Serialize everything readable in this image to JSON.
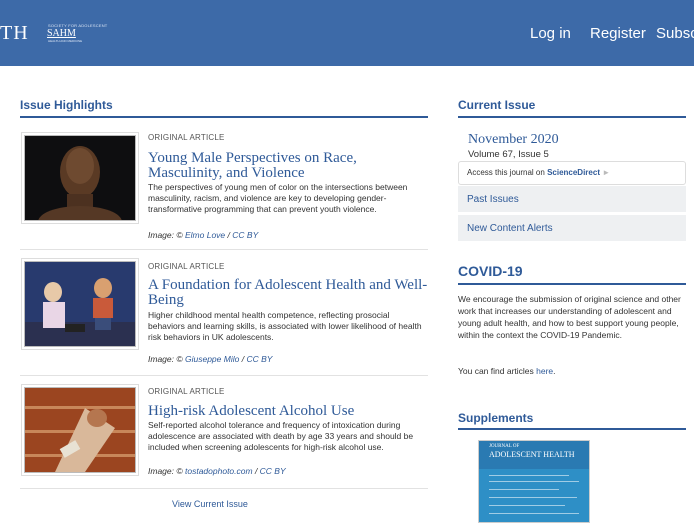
{
  "header": {
    "brand_partial": "TH",
    "logo_main": "SAHM",
    "logo_small": "SOCIETY FOR ADOLESCENT",
    "logo_sub": "HEALTH AND MEDICINE",
    "nav": {
      "login": "Log in",
      "register": "Register",
      "subscribe": "Subsc"
    }
  },
  "highlights": {
    "title": "Issue Highlights",
    "articles": [
      {
        "type": "ORIGINAL ARTICLE",
        "title": "Young Male Perspectives on Race, Masculinity, and Violence",
        "description": "The perspectives of young men of color on the intersections between masculinity, racism, and violence are key to developing gender-transformative programming that can prevent youth violence.",
        "credit_prefix": "Image: ©",
        "credit_name": "Elmo Love",
        "credit_license": "CC BY"
      },
      {
        "type": "ORIGINAL ARTICLE",
        "title": "A Foundation for Adolescent Health and Well-Being",
        "description": "Higher childhood mental health competence, reflecting prosocial behaviors and learning skills, is associated with lower likelihood of health risk behaviors in UK adolescents.",
        "credit_prefix": "Image: ©",
        "credit_name": "Giuseppe Milo",
        "credit_license": "CC BY"
      },
      {
        "type": "ORIGINAL ARTICLE",
        "title": "High-risk Adolescent Alcohol Use",
        "description": "Self-reported alcohol tolerance and frequency of intoxication during adolescence are associated with death by age 33 years and should be included when screening adolescents for high-risk alcohol use.",
        "credit_prefix": "Image: ©",
        "credit_name": "tostadophoto.com",
        "credit_license": "CC BY"
      }
    ],
    "view_current": "View Current Issue"
  },
  "current_issue": {
    "title": "Current Issue",
    "date": "November 2020",
    "volume": "Volume 67, Issue 5",
    "access_prefix": "Access this journal on",
    "access_brand": "ScienceDirect",
    "past_issues": "Past Issues",
    "alerts": "New Content Alerts"
  },
  "covid": {
    "title": "COVID-19",
    "body": "We encourage the submission of original science and other work that increases our understanding of adolescent and young adult health, and how to best support young people, within the context the COVID-19 Pandemic.",
    "find_prefix": "You can find articles",
    "find_link": "here",
    "find_suffix": "."
  },
  "supplements": {
    "title": "Supplements",
    "cover_journal_small": "JOURNAL OF",
    "cover_journal": "ADOLESCENT HEALTH"
  },
  "colors": {
    "header": "#3d6aa8",
    "accent": "#2f5a98",
    "panel": "#eef0f2"
  }
}
